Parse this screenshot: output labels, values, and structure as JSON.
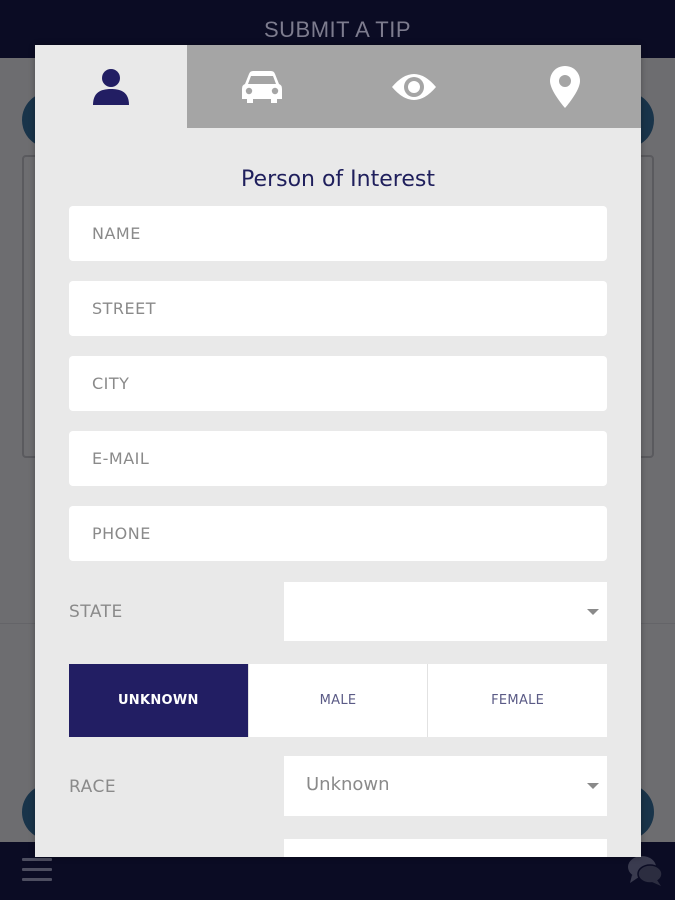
{
  "header": {
    "title": "SUBMIT A TIP"
  },
  "icons": {
    "menu": "hamburger-menu-icon",
    "chat": "chat-bubbles-icon"
  },
  "tabs": [
    {
      "icon": "person-icon",
      "active": true
    },
    {
      "icon": "car-icon",
      "active": false
    },
    {
      "icon": "eye-icon",
      "active": false
    },
    {
      "icon": "map-pin-icon",
      "active": false
    }
  ],
  "form": {
    "title": "Person of Interest",
    "name_placeholder": "NAME",
    "street_placeholder": "STREET",
    "city_placeholder": "CITY",
    "email_placeholder": "E-MAIL",
    "phone_placeholder": "PHONE",
    "state_label": "STATE",
    "state_value": "",
    "gender": {
      "options": [
        "UNKNOWN",
        "MALE",
        "FEMALE"
      ],
      "selected": "UNKNOWN"
    },
    "race_label": "RACE",
    "race_value": "Unknown"
  },
  "colors": {
    "accent": "#221e63",
    "title": "#1f1f5c",
    "tab_inactive": "#a5a5a5",
    "modal_bg": "#e9e9e9",
    "header_bg": "#0b0c24"
  }
}
